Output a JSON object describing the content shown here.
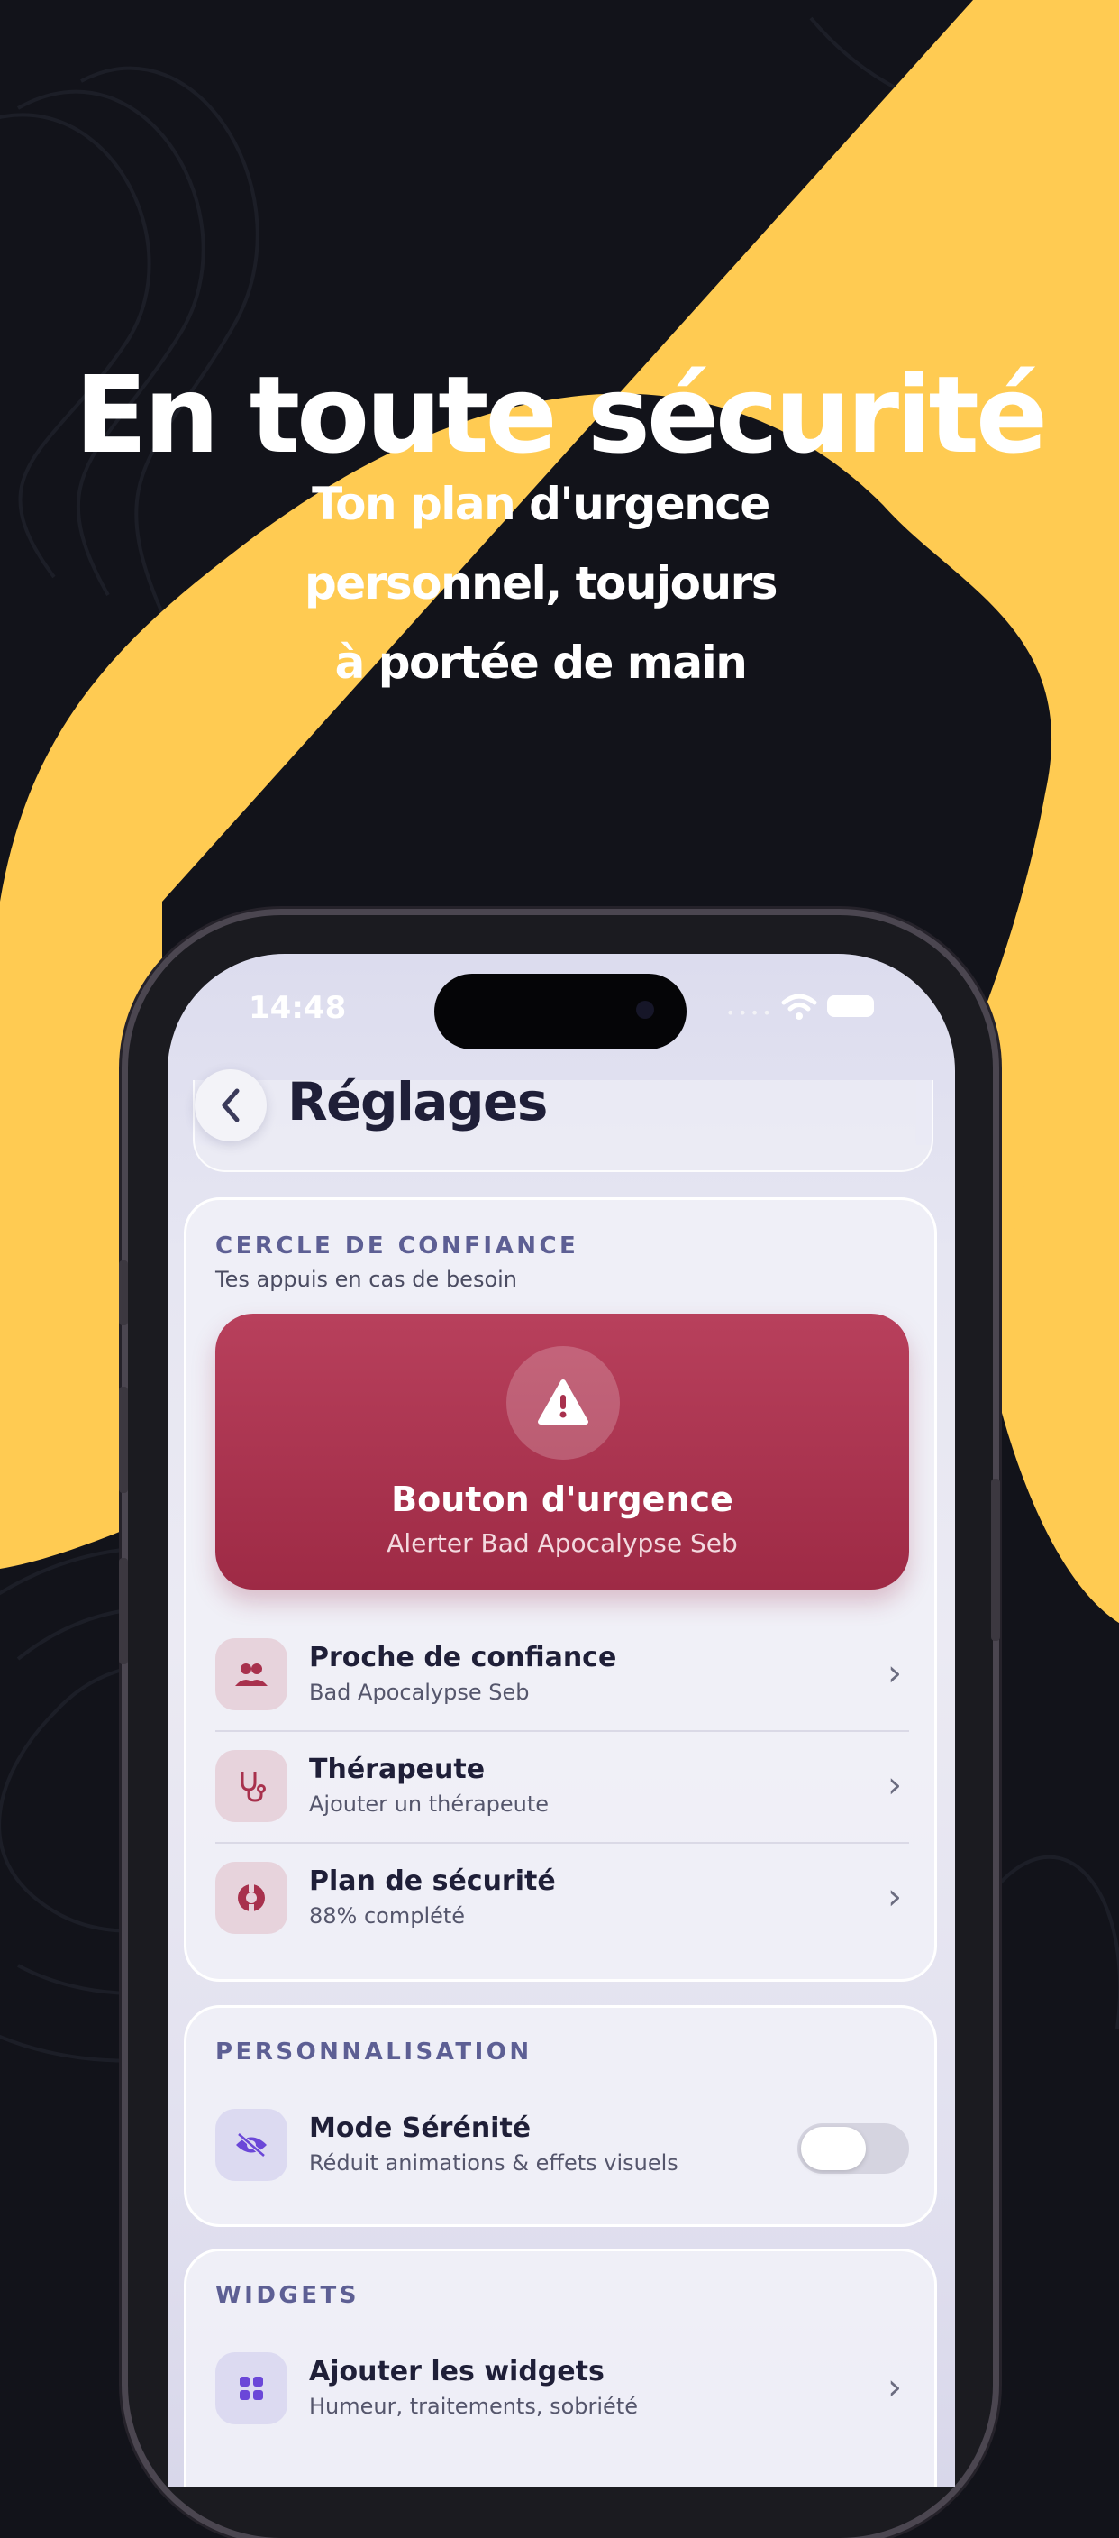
{
  "promo": {
    "headline": "En toute sécurité",
    "subtitle_lines": [
      "Ton plan d'urgence",
      "personnel, toujours",
      "à portée de main"
    ]
  },
  "status_bar": {
    "time": "14:48",
    "dots": "••••"
  },
  "header": {
    "back_icon": "chevron-left-icon",
    "title": "Réglages"
  },
  "trust_circle": {
    "section_title": "CERCLE DE CONFIANCE",
    "section_subtitle": "Tes appuis en cas de besoin",
    "emergency": {
      "icon": "warning-icon",
      "title": "Bouton d'urgence",
      "subtitle": "Alerter Bad Apocalypse Seb"
    },
    "items": [
      {
        "icon": "people-icon",
        "title": "Proche de confiance",
        "subtitle": "Bad Apocalypse Seb"
      },
      {
        "icon": "stethoscope-icon",
        "title": "Thérapeute",
        "subtitle": "Ajouter un thérapeute"
      },
      {
        "icon": "lifebuoy-icon",
        "title": "Plan de sécurité",
        "subtitle": "88% complété"
      }
    ]
  },
  "personalisation": {
    "section_title": "PERSONNALISATION",
    "item": {
      "icon": "eye-off-icon",
      "title": "Mode Sérénité",
      "subtitle": "Réduit animations & effets visuels",
      "toggle_on": false
    }
  },
  "widgets": {
    "section_title": "WIDGETS",
    "item": {
      "icon": "grid-icon",
      "title": "Ajouter les widgets",
      "subtitle": "Humeur, traitements, sobriété"
    }
  },
  "colors": {
    "background": "#12131a",
    "accent_yellow": "#ffcb52",
    "emergency_red": "#a8314d",
    "section_text": "#5d5f94"
  }
}
